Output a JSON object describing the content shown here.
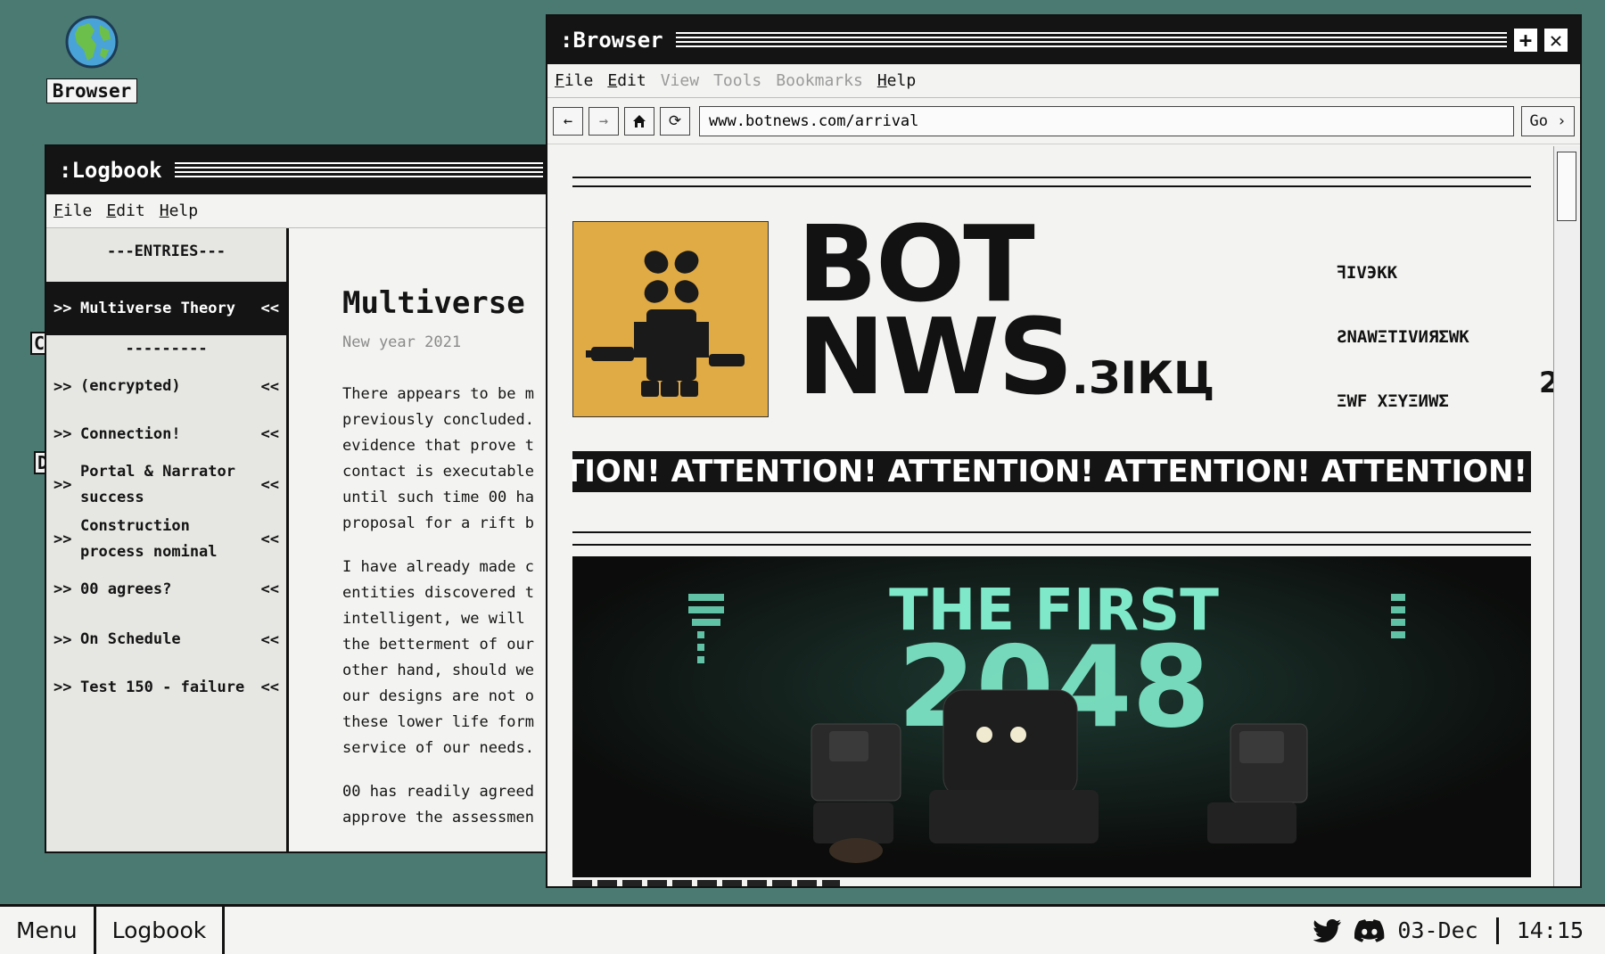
{
  "desktop": {
    "icons": [
      {
        "label": "Browser",
        "icon": "globe-icon"
      }
    ],
    "stubs": [
      "C",
      "D"
    ]
  },
  "logbook": {
    "title": ":Logbook",
    "menu": [
      "File",
      "Edit",
      "Help"
    ],
    "entries_header": "---ENTRIES---",
    "separator": "---------",
    "entries": [
      {
        "label": "Multiverse Theory",
        "active": true
      },
      {
        "label": "(encrypted)"
      },
      {
        "label": "Connection!"
      },
      {
        "label": "Portal & Narrator success"
      },
      {
        "label": "Construction process nominal"
      },
      {
        "label": "00 agrees?"
      },
      {
        "label": "On Schedule"
      },
      {
        "label": "Test 150 - failure"
      }
    ],
    "entry_prefix": ">>",
    "entry_suffix": "<<",
    "article": {
      "title": "Multiverse",
      "date": "New year 2021",
      "paragraphs": [
        "There appears to be m\npreviously concluded.\nevidence that prove t\ncontact is executable\nuntil such time 00 ha\nproposal for a rift b",
        "I have already made c\nentities discovered t\nintelligent, we will\nthe betterment of our\nother hand, should we\nour designs are not o\nthese lower life form\nservice of our needs.",
        "00 has readily agreed\napprove the assessmen"
      ]
    }
  },
  "browser": {
    "title": ":Browser",
    "menu": [
      {
        "label": "File",
        "enabled": true
      },
      {
        "label": "Edit",
        "enabled": true
      },
      {
        "label": "View",
        "enabled": false
      },
      {
        "label": "Tools",
        "enabled": false
      },
      {
        "label": "Bookmarks",
        "enabled": false
      },
      {
        "label": "Help",
        "enabled": true
      }
    ],
    "url": "www.botnews.com/arrival",
    "go_label": "Go",
    "page": {
      "brand_line1": "BOT",
      "brand_line2": "NWS",
      "brand_suffix": ".ЗІКЦ",
      "glyph_lines": [
        "ꟻIVЭKK",
        "ƧNAWΞTIVИЯΣWK",
        "ΞWF ΧΞΥΞИWΣ"
      ],
      "edge_number": "2",
      "ticker": "TION! ATTENTION! ATTENTION! ATTENTION! ATTENTION! ATTEN",
      "hero_line1": "THE FIRST",
      "hero_line2": "2048"
    }
  },
  "taskbar": {
    "items": [
      "Menu",
      "Logbook"
    ],
    "date": "03-Dec",
    "time": "14:15",
    "icons": [
      "twitter-icon",
      "discord-icon"
    ]
  }
}
